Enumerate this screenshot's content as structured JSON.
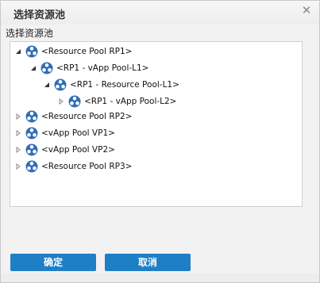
{
  "dialog": {
    "title": "选择资源池",
    "close_symbol": "✕"
  },
  "section_label": "选择资源池",
  "tree": {
    "nodes": [
      {
        "label": "<Resource Pool RP1>",
        "level": 0,
        "expanded": true,
        "icon": "resource-pool-icon"
      },
      {
        "label": "<RP1 - vApp Pool-L1>",
        "level": 1,
        "expanded": true,
        "icon": "resource-pool-icon"
      },
      {
        "label": "<RP1 - Resource Pool-L1>",
        "level": 2,
        "expanded": true,
        "icon": "resource-pool-icon"
      },
      {
        "label": "<RP1 - vApp Pool-L2>",
        "level": 3,
        "expanded": false,
        "icon": "resource-pool-icon"
      },
      {
        "label": "<Resource Pool RP2>",
        "level": 0,
        "expanded": false,
        "icon": "resource-pool-icon"
      },
      {
        "label": "<vApp Pool VP1>",
        "level": 0,
        "expanded": false,
        "icon": "resource-pool-icon"
      },
      {
        "label": "<vApp Pool VP2>",
        "level": 0,
        "expanded": false,
        "icon": "resource-pool-icon"
      },
      {
        "label": "<Resource Pool RP3>",
        "level": 0,
        "expanded": false,
        "icon": "resource-pool-icon"
      }
    ]
  },
  "buttons": {
    "ok_label": "确定",
    "cancel_label": "取消"
  },
  "colors": {
    "primary_button": "#1f7fc6",
    "icon_blue": "#2f6db5"
  }
}
